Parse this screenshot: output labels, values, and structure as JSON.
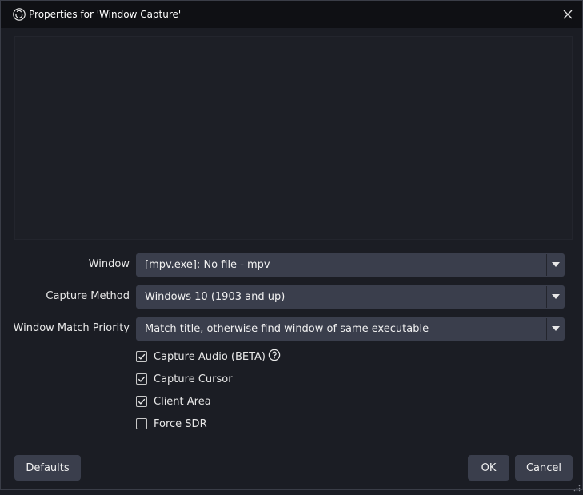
{
  "window": {
    "title": "Properties for 'Window Capture'"
  },
  "icons": {
    "app": "obs-logo-icon",
    "close": "close-icon",
    "dropdown": "chevron-down-icon",
    "help": "question-circle-icon",
    "check": "check-icon",
    "resize": "resize-grip-icon"
  },
  "colors": {
    "titlebar": "#0f1014",
    "background": "#1b1d24",
    "control": "#3a3e4c"
  },
  "fields": [
    {
      "label": "Window",
      "value": "[mpv.exe]: No file - mpv"
    },
    {
      "label": "Capture Method",
      "value": "Windows 10 (1903 and up)"
    },
    {
      "label": "Window Match Priority",
      "value": "Match title, otherwise find window of same executable"
    }
  ],
  "checkboxes": [
    {
      "label": "Capture Audio (BETA)",
      "checked": true,
      "has_help": true
    },
    {
      "label": "Capture Cursor",
      "checked": true
    },
    {
      "label": "Client Area",
      "checked": true
    },
    {
      "label": "Force SDR",
      "checked": false
    }
  ],
  "buttons": {
    "defaults": "Defaults",
    "ok": "OK",
    "cancel": "Cancel"
  }
}
